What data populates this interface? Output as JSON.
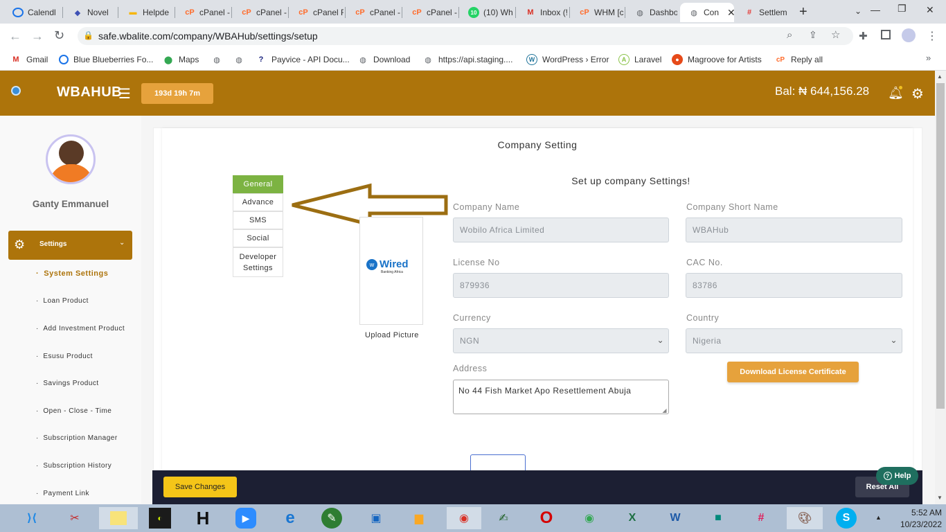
{
  "browser": {
    "tabs": [
      {
        "title": "Calendl"
      },
      {
        "title": "Novel"
      },
      {
        "title": "Helpde"
      },
      {
        "title": "cPanel -"
      },
      {
        "title": "cPanel -"
      },
      {
        "title": "cPanel F"
      },
      {
        "title": "cPanel -"
      },
      {
        "title": "cPanel -"
      },
      {
        "title": "(10) Wh"
      },
      {
        "title": "Inbox (!"
      },
      {
        "title": "WHM [c"
      },
      {
        "title": "Dashbo"
      },
      {
        "title": "Con"
      },
      {
        "title": "Settlem"
      }
    ],
    "tab_badge": "10",
    "url": "safe.wbalite.com/company/WBAHub/settings/setup",
    "bookmarks": [
      {
        "label": "Gmail"
      },
      {
        "label": "Blue Blueberries Fo..."
      },
      {
        "label": "Maps"
      },
      {
        "label": ""
      },
      {
        "label": ""
      },
      {
        "label": "Payvice - API Docu..."
      },
      {
        "label": "Download"
      },
      {
        "label": "https://api.staging...."
      },
      {
        "label": "WordPress › Error"
      },
      {
        "label": "Laravel"
      },
      {
        "label": "Magroove for Artists"
      },
      {
        "label": "Reply all"
      }
    ]
  },
  "header": {
    "brand": "WBAHUB",
    "countdown": "193d 19h 7m",
    "balance": "Bal: ₦ 644,156.28"
  },
  "sidebar": {
    "user_name": "Ganty Emmanuel",
    "active_section": "Settings",
    "items": [
      {
        "label": "System Settings"
      },
      {
        "label": "Loan Product"
      },
      {
        "label": "Add Investment Product"
      },
      {
        "label": "Esusu Product"
      },
      {
        "label": "Savings Product"
      },
      {
        "label": "Open - Close - Time"
      },
      {
        "label": "Subscription Manager"
      },
      {
        "label": "Subscription History"
      },
      {
        "label": "Payment Link"
      }
    ]
  },
  "page": {
    "title": "Company Setting",
    "subtitle": "Set up company Settings!",
    "tabs": [
      {
        "label": "General"
      },
      {
        "label": "Advance"
      },
      {
        "label": "SMS"
      },
      {
        "label": "Social"
      },
      {
        "label": "Developer Settings"
      }
    ],
    "logo_text": "Wired",
    "logo_subtext": "Banking Africa",
    "upload_label": "Upload Picture",
    "fields": {
      "company_name": {
        "label": "Company Name",
        "value": "Wobilo Africa Limited"
      },
      "short_name": {
        "label": "Company Short Name",
        "value": "WBAHub"
      },
      "license_no": {
        "label": "License No",
        "value": "879936"
      },
      "cac_no": {
        "label": "CAC No.",
        "value": "83786"
      },
      "currency": {
        "label": "Currency",
        "value": "NGN"
      },
      "country": {
        "label": "Country",
        "value": "Nigeria"
      },
      "address": {
        "label": "Address",
        "value": "No 44 Fish Market Apo Resettlement Abuja"
      }
    },
    "download_button": "Download License Certificate",
    "save_button": "Save Changes",
    "reset_button": "Reset All",
    "help_button": "Help"
  },
  "taskbar": {
    "time": "5:52 AM",
    "date": "10/23/2022"
  },
  "colors": {
    "brand": "#ad740b",
    "accent": "#e6a23c",
    "active_tab": "#7cb342",
    "bottom_bar": "#1c1f33",
    "save_button": "#f5c518",
    "help": "#1f6f5f"
  }
}
